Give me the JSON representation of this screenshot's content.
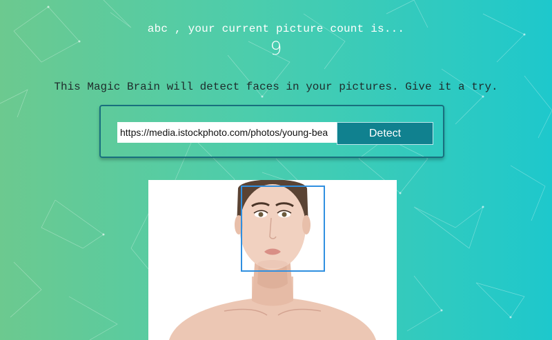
{
  "rank": {
    "message": "abc , your current picture count is...",
    "count": "9"
  },
  "intro": {
    "text": "This Magic Brain will detect faces in your pictures. Give it a try."
  },
  "form": {
    "url_value": "https://media.istockphoto.com/photos/young-bea",
    "detect_label": "Detect"
  },
  "colors": {
    "gradient_start": "#6cc98f",
    "gradient_end": "#1ec8cc",
    "button": "#10818f",
    "face_box": "#2f8fe0"
  }
}
